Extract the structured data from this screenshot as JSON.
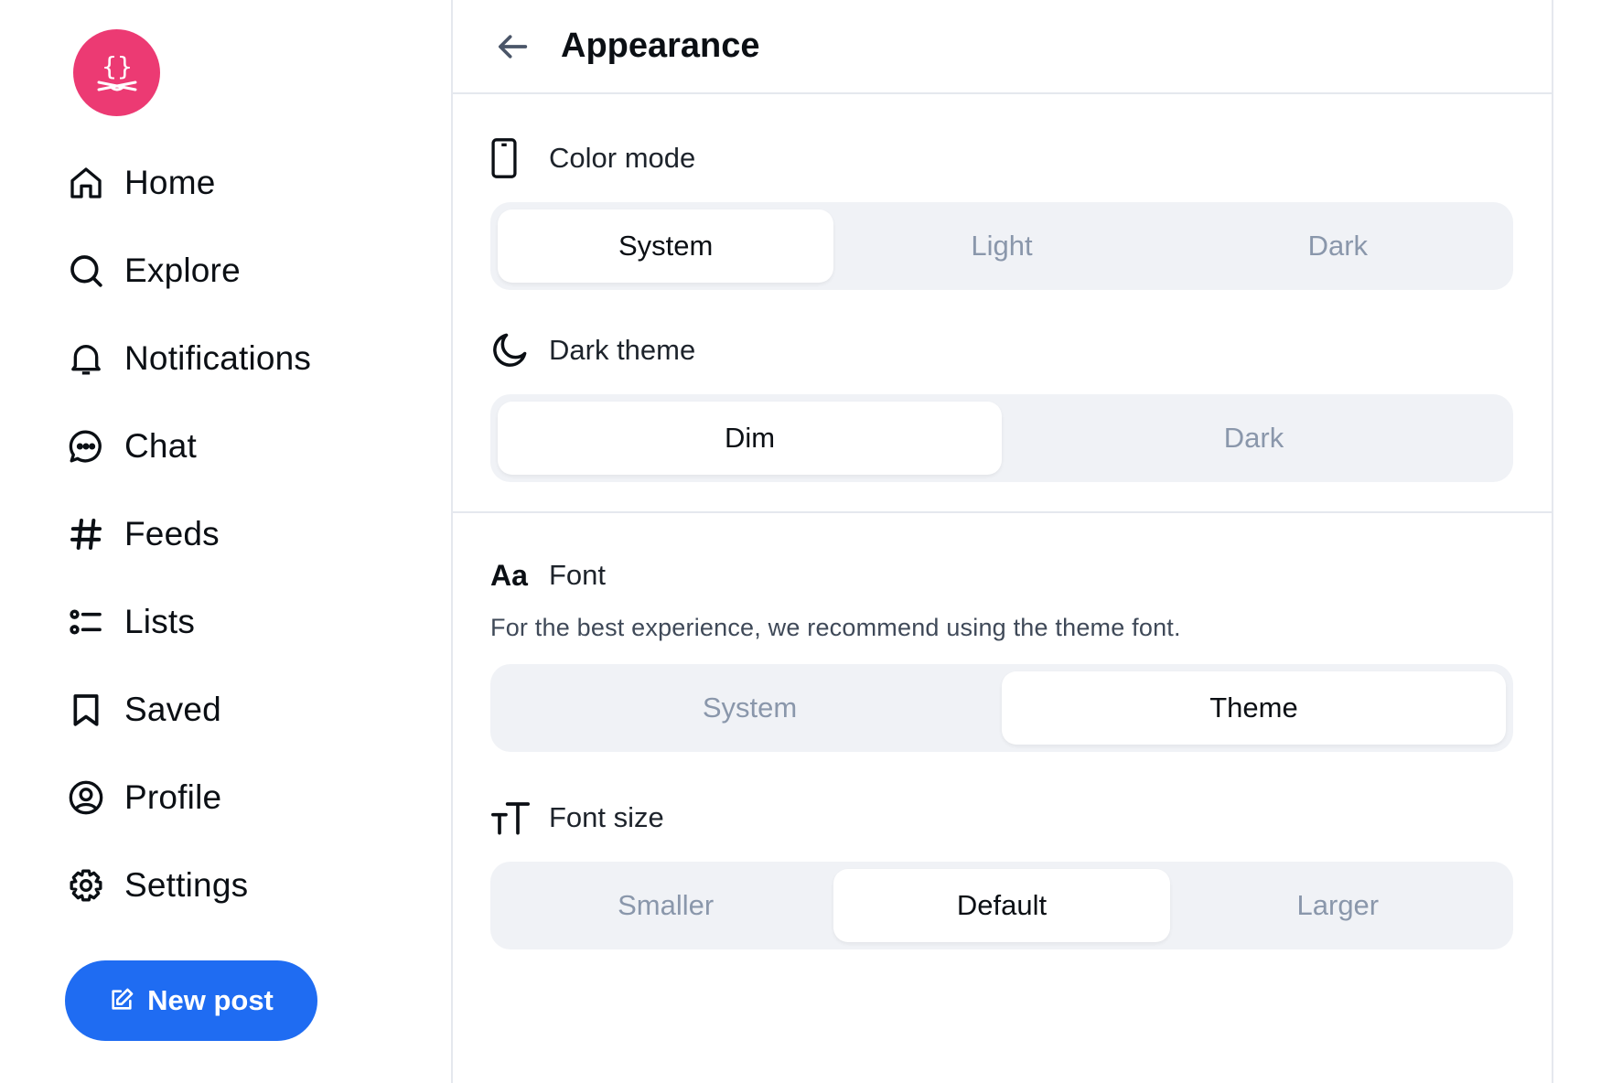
{
  "sidebar": {
    "logo_icon": "butterfly-code-logo",
    "items": [
      {
        "label": "Home",
        "icon": "home-icon"
      },
      {
        "label": "Explore",
        "icon": "search-icon"
      },
      {
        "label": "Notifications",
        "icon": "bell-icon"
      },
      {
        "label": "Chat",
        "icon": "chat-bubble-icon"
      },
      {
        "label": "Feeds",
        "icon": "hash-icon"
      },
      {
        "label": "Lists",
        "icon": "list-icon"
      },
      {
        "label": "Saved",
        "icon": "bookmark-icon"
      },
      {
        "label": "Profile",
        "icon": "user-circle-icon"
      },
      {
        "label": "Settings",
        "icon": "gear-icon"
      }
    ],
    "new_post_label": "New post"
  },
  "header": {
    "title": "Appearance"
  },
  "color_mode": {
    "label": "Color mode",
    "options": [
      "System",
      "Light",
      "Dark"
    ],
    "selected": "System"
  },
  "dark_theme": {
    "label": "Dark theme",
    "options": [
      "Dim",
      "Dark"
    ],
    "selected": "Dim"
  },
  "font": {
    "label": "Font",
    "icon_text": "Aa",
    "hint": "For the best experience, we recommend using the theme font.",
    "options": [
      "System",
      "Theme"
    ],
    "selected": "Theme"
  },
  "font_size": {
    "label": "Font size",
    "options": [
      "Smaller",
      "Default",
      "Larger"
    ],
    "selected": "Default"
  },
  "colors": {
    "accent": "#1f6cf2",
    "logo": "#ec3a73",
    "segment_bg": "#f0f2f6",
    "inactive_text": "#8a97ab"
  }
}
